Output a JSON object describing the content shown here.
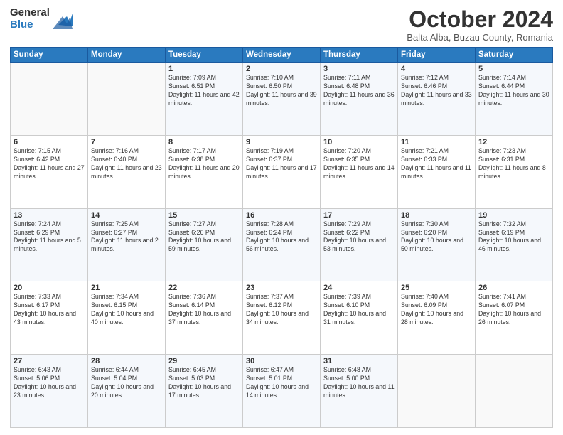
{
  "logo": {
    "general": "General",
    "blue": "Blue"
  },
  "header": {
    "month": "October 2024",
    "location": "Balta Alba, Buzau County, Romania"
  },
  "days_of_week": [
    "Sunday",
    "Monday",
    "Tuesday",
    "Wednesday",
    "Thursday",
    "Friday",
    "Saturday"
  ],
  "weeks": [
    [
      {
        "day": "",
        "info": ""
      },
      {
        "day": "",
        "info": ""
      },
      {
        "day": "1",
        "info": "Sunrise: 7:09 AM\nSunset: 6:51 PM\nDaylight: 11 hours and 42 minutes."
      },
      {
        "day": "2",
        "info": "Sunrise: 7:10 AM\nSunset: 6:50 PM\nDaylight: 11 hours and 39 minutes."
      },
      {
        "day": "3",
        "info": "Sunrise: 7:11 AM\nSunset: 6:48 PM\nDaylight: 11 hours and 36 minutes."
      },
      {
        "day": "4",
        "info": "Sunrise: 7:12 AM\nSunset: 6:46 PM\nDaylight: 11 hours and 33 minutes."
      },
      {
        "day": "5",
        "info": "Sunrise: 7:14 AM\nSunset: 6:44 PM\nDaylight: 11 hours and 30 minutes."
      }
    ],
    [
      {
        "day": "6",
        "info": "Sunrise: 7:15 AM\nSunset: 6:42 PM\nDaylight: 11 hours and 27 minutes."
      },
      {
        "day": "7",
        "info": "Sunrise: 7:16 AM\nSunset: 6:40 PM\nDaylight: 11 hours and 23 minutes."
      },
      {
        "day": "8",
        "info": "Sunrise: 7:17 AM\nSunset: 6:38 PM\nDaylight: 11 hours and 20 minutes."
      },
      {
        "day": "9",
        "info": "Sunrise: 7:19 AM\nSunset: 6:37 PM\nDaylight: 11 hours and 17 minutes."
      },
      {
        "day": "10",
        "info": "Sunrise: 7:20 AM\nSunset: 6:35 PM\nDaylight: 11 hours and 14 minutes."
      },
      {
        "day": "11",
        "info": "Sunrise: 7:21 AM\nSunset: 6:33 PM\nDaylight: 11 hours and 11 minutes."
      },
      {
        "day": "12",
        "info": "Sunrise: 7:23 AM\nSunset: 6:31 PM\nDaylight: 11 hours and 8 minutes."
      }
    ],
    [
      {
        "day": "13",
        "info": "Sunrise: 7:24 AM\nSunset: 6:29 PM\nDaylight: 11 hours and 5 minutes."
      },
      {
        "day": "14",
        "info": "Sunrise: 7:25 AM\nSunset: 6:27 PM\nDaylight: 11 hours and 2 minutes."
      },
      {
        "day": "15",
        "info": "Sunrise: 7:27 AM\nSunset: 6:26 PM\nDaylight: 10 hours and 59 minutes."
      },
      {
        "day": "16",
        "info": "Sunrise: 7:28 AM\nSunset: 6:24 PM\nDaylight: 10 hours and 56 minutes."
      },
      {
        "day": "17",
        "info": "Sunrise: 7:29 AM\nSunset: 6:22 PM\nDaylight: 10 hours and 53 minutes."
      },
      {
        "day": "18",
        "info": "Sunrise: 7:30 AM\nSunset: 6:20 PM\nDaylight: 10 hours and 50 minutes."
      },
      {
        "day": "19",
        "info": "Sunrise: 7:32 AM\nSunset: 6:19 PM\nDaylight: 10 hours and 46 minutes."
      }
    ],
    [
      {
        "day": "20",
        "info": "Sunrise: 7:33 AM\nSunset: 6:17 PM\nDaylight: 10 hours and 43 minutes."
      },
      {
        "day": "21",
        "info": "Sunrise: 7:34 AM\nSunset: 6:15 PM\nDaylight: 10 hours and 40 minutes."
      },
      {
        "day": "22",
        "info": "Sunrise: 7:36 AM\nSunset: 6:14 PM\nDaylight: 10 hours and 37 minutes."
      },
      {
        "day": "23",
        "info": "Sunrise: 7:37 AM\nSunset: 6:12 PM\nDaylight: 10 hours and 34 minutes."
      },
      {
        "day": "24",
        "info": "Sunrise: 7:39 AM\nSunset: 6:10 PM\nDaylight: 10 hours and 31 minutes."
      },
      {
        "day": "25",
        "info": "Sunrise: 7:40 AM\nSunset: 6:09 PM\nDaylight: 10 hours and 28 minutes."
      },
      {
        "day": "26",
        "info": "Sunrise: 7:41 AM\nSunset: 6:07 PM\nDaylight: 10 hours and 26 minutes."
      }
    ],
    [
      {
        "day": "27",
        "info": "Sunrise: 6:43 AM\nSunset: 5:06 PM\nDaylight: 10 hours and 23 minutes."
      },
      {
        "day": "28",
        "info": "Sunrise: 6:44 AM\nSunset: 5:04 PM\nDaylight: 10 hours and 20 minutes."
      },
      {
        "day": "29",
        "info": "Sunrise: 6:45 AM\nSunset: 5:03 PM\nDaylight: 10 hours and 17 minutes."
      },
      {
        "day": "30",
        "info": "Sunrise: 6:47 AM\nSunset: 5:01 PM\nDaylight: 10 hours and 14 minutes."
      },
      {
        "day": "31",
        "info": "Sunrise: 6:48 AM\nSunset: 5:00 PM\nDaylight: 10 hours and 11 minutes."
      },
      {
        "day": "",
        "info": ""
      },
      {
        "day": "",
        "info": ""
      }
    ]
  ]
}
